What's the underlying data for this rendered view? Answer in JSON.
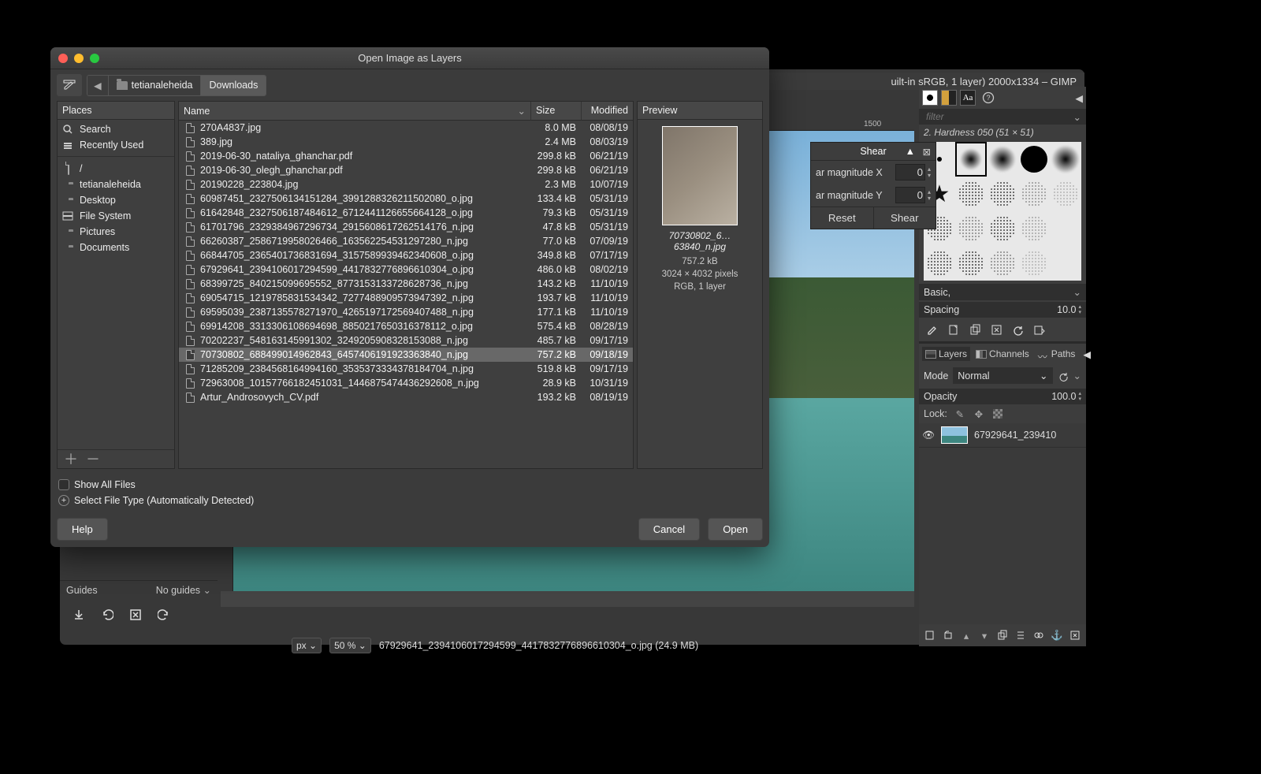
{
  "gimp": {
    "title_suffix": "uilt-in sRGB, 1 layer) 2000x1334 – GIMP",
    "ruler_mark_1500": "1500",
    "status": {
      "unit": "px",
      "zoom": "50 %",
      "filename": "67929641_2394106017294599_4417832776896610304_o.jpg (24.9 MB)"
    },
    "left_panel": {
      "guides_label": "Guides",
      "guides_value": "No guides"
    },
    "shear": {
      "title": "Shear",
      "row_x": "ar magnitude X",
      "row_y": "ar magnitude Y",
      "val_x": "0",
      "val_y": "0",
      "reset": "Reset",
      "apply": "Shear"
    },
    "right_panel": {
      "filter_placeholder": "filter",
      "brush_label": "2. Hardness 050 (51 × 51)",
      "basic_label": "Basic,",
      "spacing_label": "Spacing",
      "spacing_value": "10.0",
      "tabs": {
        "layers": "Layers",
        "channels": "Channels",
        "paths": "Paths"
      },
      "mode_label": "Mode",
      "mode_value": "Normal",
      "opacity_label": "Opacity",
      "opacity_value": "100.0",
      "lock_label": "Lock:",
      "layer_name": "67929641_239410"
    }
  },
  "dialog": {
    "title": "Open Image as Layers",
    "crumbs": [
      "tetianaleheida",
      "Downloads"
    ],
    "places_header": "Places",
    "places_top": [
      {
        "label": "Search",
        "icon": "search"
      },
      {
        "label": "Recently Used",
        "icon": "clock"
      }
    ],
    "places": [
      {
        "label": "/",
        "icon": "doc"
      },
      {
        "label": "tetianaleheida",
        "icon": "folder"
      },
      {
        "label": "Desktop",
        "icon": "folder"
      },
      {
        "label": "File System",
        "icon": "disk"
      },
      {
        "label": "Pictures",
        "icon": "folder"
      },
      {
        "label": "Documents",
        "icon": "folder"
      }
    ],
    "cols": {
      "name": "Name",
      "size": "Size",
      "modified": "Modified"
    },
    "files": [
      {
        "name": "270A4837.jpg",
        "size": "8.0 MB",
        "modified": "08/08/19"
      },
      {
        "name": "389.jpg",
        "size": "2.4 MB",
        "modified": "08/03/19"
      },
      {
        "name": "2019-06-30_nataliya_ghanchar.pdf",
        "size": "299.8 kB",
        "modified": "06/21/19"
      },
      {
        "name": "2019-06-30_olegh_ghanchar.pdf",
        "size": "299.8 kB",
        "modified": "06/21/19"
      },
      {
        "name": "20190228_223804.jpg",
        "size": "2.3 MB",
        "modified": "10/07/19"
      },
      {
        "name": "60987451_2327506134151284_3991288326211502080_o.jpg",
        "size": "133.4 kB",
        "modified": "05/31/19"
      },
      {
        "name": "61642848_2327506187484612_6712441126655664128_o.jpg",
        "size": "79.3 kB",
        "modified": "05/31/19"
      },
      {
        "name": "61701796_2329384967296734_2915608617262514176_n.jpg",
        "size": "47.8 kB",
        "modified": "05/31/19"
      },
      {
        "name": "66260387_2586719958026466_163562254531297280_n.jpg",
        "size": "77.0 kB",
        "modified": "07/09/19"
      },
      {
        "name": "66844705_2365401736831694_315758993946234060​8_o.jpg",
        "size": "349.8 kB",
        "modified": "07/17/19"
      },
      {
        "name": "67929641_2394106017294599_4417832776896610304_o.jpg",
        "size": "486.0 kB",
        "modified": "08/02/19"
      },
      {
        "name": "68399725_840215099695552_8773153133728628736_n.jpg",
        "size": "143.2 kB",
        "modified": "11/10/19"
      },
      {
        "name": "69054715_1219785831534342_7277488909573947392_n.jpg",
        "size": "193.7 kB",
        "modified": "11/10/19"
      },
      {
        "name": "69595039_2387135578271970_4265197172569407488_n.jpg",
        "size": "177.1 kB",
        "modified": "11/10/19"
      },
      {
        "name": "69914208_3313306108694698_8850217650316378112_o.jpg",
        "size": "575.4 kB",
        "modified": "08/28/19"
      },
      {
        "name": "70202237_548163145991302_3249205908328153088_n.jpg",
        "size": "485.7 kB",
        "modified": "09/17/19"
      },
      {
        "name": "70730802_688499014962843_6457406191923363840_n.jpg",
        "size": "757.2 kB",
        "modified": "09/18/19",
        "selected": true
      },
      {
        "name": "71285209_2384568164994160_3535373334378184704_n.jpg",
        "size": "519.8 kB",
        "modified": "09/17/19"
      },
      {
        "name": "72963008_10157766182451031_1446875474436292608_n.jpg",
        "size": "28.9 kB",
        "modified": "10/31/19"
      },
      {
        "name": "Artur_Androsovych_CV.pdf",
        "size": "193.2 kB",
        "modified": "08/19/19"
      }
    ],
    "preview": {
      "title": "Preview",
      "filename": "70730802_6…63840_n.jpg",
      "size": "757.2 kB",
      "dimensions": "3024 × 4032 pixels",
      "mode": "RGB, 1 layer"
    },
    "show_all": "Show All Files",
    "filetype": "Select File Type (Automatically Detected)",
    "btn_help": "Help",
    "btn_cancel": "Cancel",
    "btn_open": "Open"
  }
}
